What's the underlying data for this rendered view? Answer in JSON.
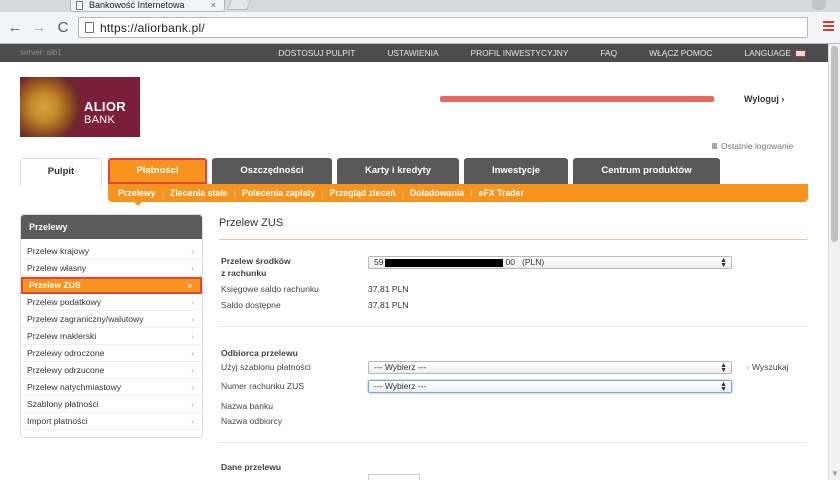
{
  "browser": {
    "tab_title": "Bankowość Internetowa",
    "tab_close": "×",
    "url": "https://aliorbank.pl/",
    "back_glyph": "←",
    "forward_glyph": "→",
    "reload_glyph": "C"
  },
  "topbar": {
    "server": "server: alb1",
    "nav": [
      "DOSTOSUJ PULPIT",
      "USTAWIENIA",
      "PROFIL INWESTYCYJNY",
      "FAQ",
      "WŁĄCZ POMOC",
      "LANGUAGE"
    ]
  },
  "header": {
    "logo_line1": "ALIOR",
    "logo_line2": "BANK",
    "logout": "Wyloguj ›",
    "last_login": "Ostatnie logowanie"
  },
  "main_tabs": [
    "Pulpit",
    "Płatności",
    "Oszczędności",
    "Karty i kredyty",
    "Inwestycje",
    "Centrum produktów"
  ],
  "sub_tabs": [
    "Przelewy",
    "Zlecenia stałe",
    "Polecenia zapłaty",
    "Przegląd zleceń",
    "Doładowania",
    "eFX Trader"
  ],
  "sidebar": {
    "title": "Przelewy",
    "items": [
      "Przelew krajowy",
      "Przelew własny",
      "Przelew ZUS",
      "Przelew podatkowy",
      "Przelew zagraniczny/walutowy",
      "Przelew maklerski",
      "Przelewy odroczone",
      "Przelewy odrzucone",
      "Przelew natychmiastowy",
      "Szablony płatności",
      "Import płatności"
    ],
    "active_chevron": "»",
    "chevron": "›"
  },
  "content": {
    "title": "Przelew ZUS",
    "source_label_1": "Przelew środków",
    "source_label_2": "z rachunku",
    "account_prefix": "59",
    "account_suffix": "00",
    "account_currency": "(PLN)",
    "book_balance_label": "Księgowe saldo rachunku",
    "book_balance_value": "37,81 PLN",
    "available_label": "Saldo dostępne",
    "available_value": "37,81 PLN",
    "recipient_heading": "Odbiorca przelewu",
    "template_label": "Użyj szablonu płatności",
    "template_value": "--- Wybierz ---",
    "search_link": "Wyszukaj",
    "zus_account_label": "Numer rachunku ZUS",
    "zus_account_value": "--- Wybierz ---",
    "bank_name_label": "Nazwa banku",
    "recipient_name_label": "Nazwa odbiorcy",
    "transfer_data_heading": "Dane przelewu"
  }
}
